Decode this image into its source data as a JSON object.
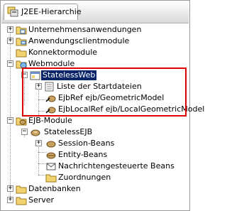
{
  "title": "J2EE-Hierarchie",
  "tree": [
    {
      "label": "Unternehmensanwendungen",
      "icon": "enterprise-app-icon"
    },
    {
      "label": "Anwendungsclientmodule",
      "icon": "client-module-icon"
    },
    {
      "label": "Konnektormodule",
      "icon": "connector-icon"
    },
    {
      "label": "Webmodule",
      "icon": "web-module-icon"
    },
    {
      "label": "StatelessWeb",
      "icon": "web-project-icon"
    },
    {
      "label": "Liste der Startdateien",
      "icon": "list-icon"
    },
    {
      "label": "EjbRef ejb/GeometricModel",
      "icon": "ejb-ref-icon"
    },
    {
      "label": "EjbLocalRef ejb/LocalGeometricModel",
      "icon": "ejb-local-ref-icon"
    },
    {
      "label": "EJB-Module",
      "icon": "ejb-module-icon"
    },
    {
      "label": "StatelessEJB",
      "icon": "ejb-project-icon"
    },
    {
      "label": "Session-Beans",
      "icon": "session-bean-icon"
    },
    {
      "label": "Entity-Beans",
      "icon": "entity-bean-icon"
    },
    {
      "label": "Nachrichtengesteuerte Beans",
      "icon": "message-bean-icon"
    },
    {
      "label": "Zuordnungen",
      "icon": "folder-icon"
    },
    {
      "label": "Datenbanken",
      "icon": "database-folder-icon"
    },
    {
      "label": "Server",
      "icon": "server-folder-icon"
    }
  ],
  "colors": {
    "selection": "#0a246a",
    "highlight_box": "#e00000",
    "folder": "#f2d470"
  }
}
